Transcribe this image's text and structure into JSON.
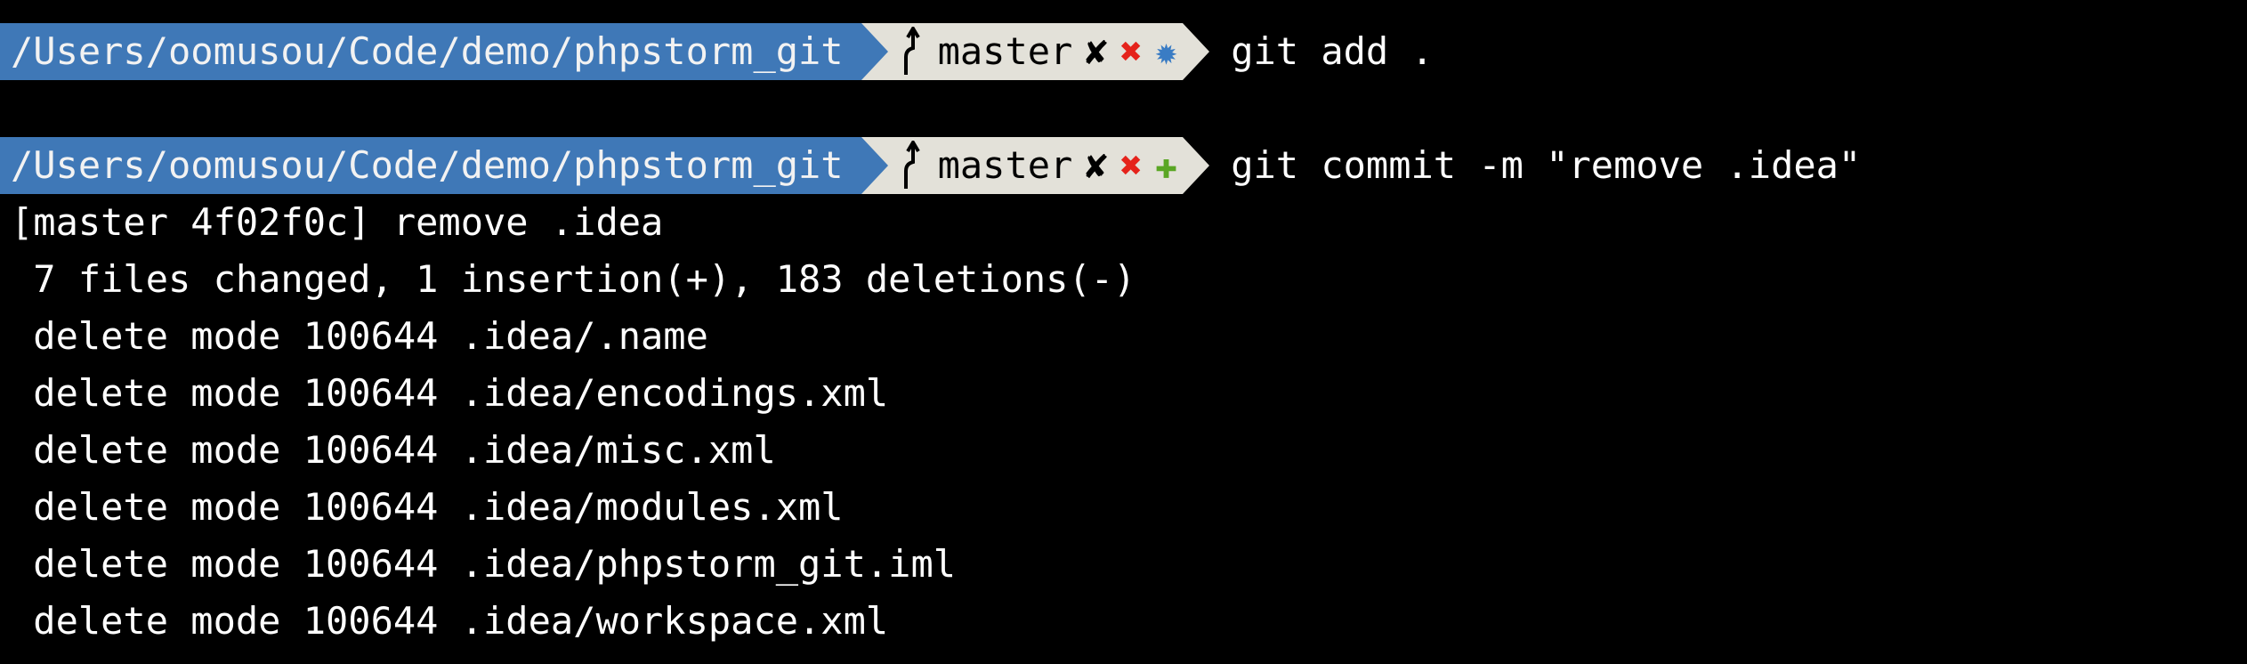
{
  "prompts": [
    {
      "path": "/Users/oomusou/Code/demo/phpstorm_git",
      "branch": "master",
      "status_icons": [
        "dirty-mark-icon",
        "conflict-x-icon",
        "untracked-star-icon"
      ],
      "command": "git add ."
    },
    {
      "path": "/Users/oomusou/Code/demo/phpstorm_git",
      "branch": "master",
      "status_icons": [
        "dirty-mark-icon",
        "conflict-x-icon",
        "staged-plus-icon"
      ],
      "command": "git commit -m \"remove .idea\""
    }
  ],
  "output": [
    "[master 4f02f0c] remove .idea",
    " 7 files changed, 1 insertion(+), 183 deletions(-)",
    " delete mode 100644 .idea/.name",
    " delete mode 100644 .idea/encodings.xml",
    " delete mode 100644 .idea/misc.xml",
    " delete mode 100644 .idea/modules.xml",
    " delete mode 100644 .idea/phpstorm_git.iml",
    " delete mode 100644 .idea/workspace.xml"
  ],
  "glyphs": {
    "dirty": "✘",
    "x": "✖",
    "star": "✹",
    "plus": "✚"
  },
  "colors": {
    "path_bg": "#3f78b7",
    "git_bg": "#e3e1d9",
    "x_red": "#e5231b",
    "star_blue": "#3a7cc4",
    "plus_green": "#5aa624"
  }
}
